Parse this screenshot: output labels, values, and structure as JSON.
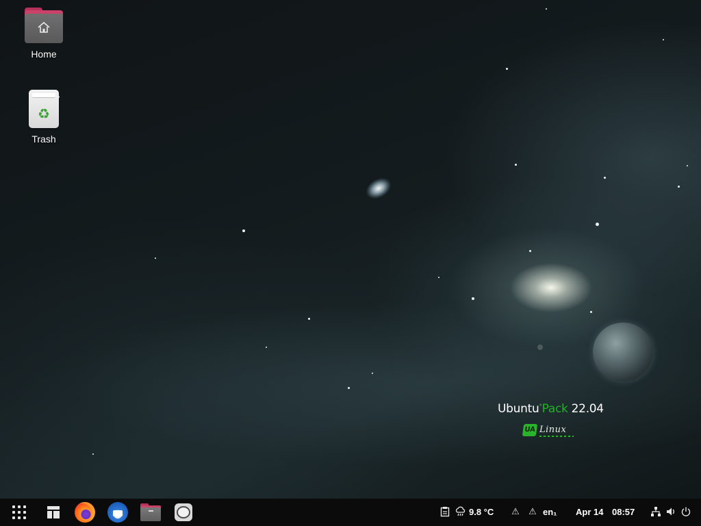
{
  "desktop": {
    "icons": [
      {
        "label": "Home",
        "icon": "home-folder-icon"
      },
      {
        "label": "Trash",
        "icon": "trash-icon"
      }
    ],
    "watermark": {
      "brand_part1": "Ubuntu",
      "brand_star": "*",
      "brand_part2": "Pack",
      "brand_version": "22.04",
      "logo_badge": "UA",
      "logo_text": "Linux"
    }
  },
  "taskbar": {
    "launchers": [
      {
        "icon": "app-grid-icon"
      },
      {
        "icon": "window-layout-icon"
      },
      {
        "icon": "firefox-icon"
      },
      {
        "icon": "thunderbird-icon"
      },
      {
        "icon": "files-icon"
      },
      {
        "icon": "chat-icon"
      }
    ],
    "tray": {
      "weather_temp": "9.8 °C",
      "keyboard_layout": "en₁",
      "date": "Apr 14",
      "time": "08:57"
    }
  },
  "colors": {
    "accent_green": "#22b02a",
    "folder_pink": "#c8426a",
    "taskbar_bg": "#0b0b0b"
  }
}
